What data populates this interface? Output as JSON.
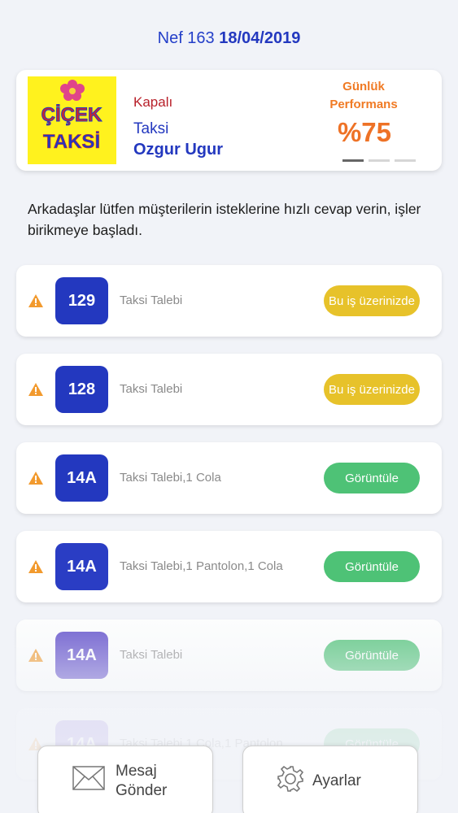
{
  "header": {
    "prefix": "Nef 163",
    "date": "18/04/2019"
  },
  "profile": {
    "logo_text_top": "ÇİÇEK",
    "logo_text_bottom": "TAKSİ",
    "status": "Kapalı",
    "category": "Taksi",
    "driver": "Ozgur Ugur",
    "performance_label": "Günlük Performans",
    "performance_value": "%75",
    "performance_percent": 75
  },
  "notice": "Arkadaşlar lütfen müşterilerin isteklerine hızlı cevap verin, işler birikmeye başladı.",
  "requests": [
    {
      "number": "129",
      "description": "Taksi Talebi",
      "action": "Bu iş üzerinizde",
      "state": "yellow",
      "badge_color": "#2338bf"
    },
    {
      "number": "128",
      "description": "Taksi Talebi",
      "action": "Bu iş üzerinizde",
      "state": "yellow",
      "badge_color": "#2338bf"
    },
    {
      "number": "14A",
      "description": "Taksi Talebi,1 Cola",
      "action": "Görüntüle",
      "state": "green",
      "badge_color": "#2338bf"
    },
    {
      "number": "14A",
      "description": "Taksi Talebi,1 Pantolon,1 Cola",
      "action": "Görüntüle",
      "state": "green",
      "badge_color": "#2a3dc4"
    },
    {
      "number": "14A",
      "description": "Taksi Talebi",
      "action": "Görüntüle",
      "state": "green",
      "badge_color": "#5b48c9"
    },
    {
      "number": "14A",
      "description": "Taksi Talebi,1 Cola,1 Pantolon",
      "action": "Görüntüle",
      "state": "green",
      "badge_color": "#8a6fe0"
    }
  ],
  "bottom": {
    "message_label_line1": "Mesaj",
    "message_label_line2": "Gönder",
    "settings_label": "Ayarlar"
  },
  "colors": {
    "brand_blue": "#2338bf",
    "accent_orange": "#ee7226",
    "yellow": "#e7c22a",
    "green": "#4ec276",
    "warning": "#f29a2e"
  },
  "icons": {
    "warning": "warning-triangle-icon",
    "message": "envelope-icon",
    "settings": "gear-icon"
  }
}
